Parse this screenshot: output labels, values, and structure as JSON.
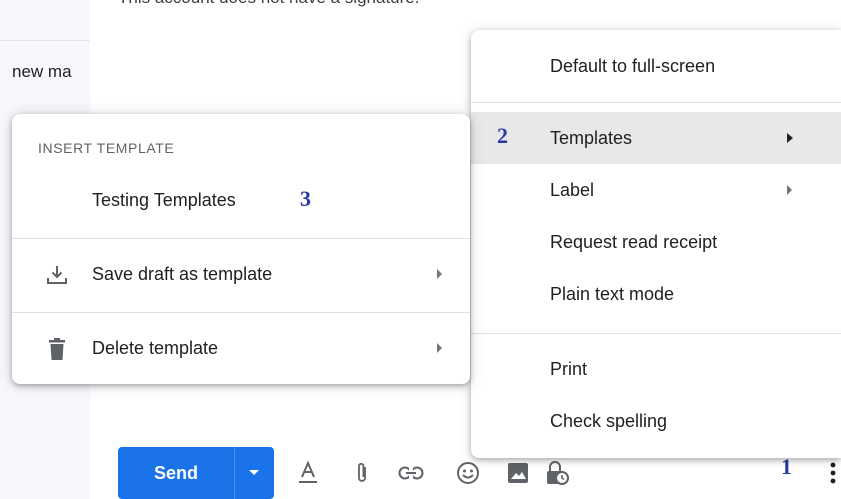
{
  "background": {
    "inbox_item_fragment": "new ma",
    "signature_text": "This account does not have a signature."
  },
  "toolbar": {
    "send_label": "Send",
    "icons": [
      "formatting-icon",
      "attach-icon",
      "link-icon",
      "emoji-icon",
      "photo-icon",
      "confidential-icon",
      "more-options-icon"
    ]
  },
  "more_options_menu": {
    "items": [
      {
        "label": "Default to full-screen"
      },
      {
        "label": "Templates",
        "has_submenu": true,
        "active": true
      },
      {
        "label": "Label",
        "has_submenu": true
      },
      {
        "label": "Request read receipt"
      },
      {
        "label": "Plain text mode"
      },
      {
        "label": "Print"
      },
      {
        "label": "Check spelling"
      }
    ]
  },
  "templates_submenu": {
    "header": "INSERT TEMPLATE",
    "items": [
      {
        "label": "Testing Templates"
      },
      {
        "label": "Save draft as template",
        "icon": "download-icon",
        "has_submenu": true
      },
      {
        "label": "Delete template",
        "icon": "trash-icon",
        "has_submenu": true
      }
    ]
  },
  "step_annotations": [
    "1",
    "2",
    "3"
  ],
  "colors": {
    "send_button": "#1a73e8",
    "annotation": "#2b3aa3",
    "active_item": "#e8e8e8"
  }
}
